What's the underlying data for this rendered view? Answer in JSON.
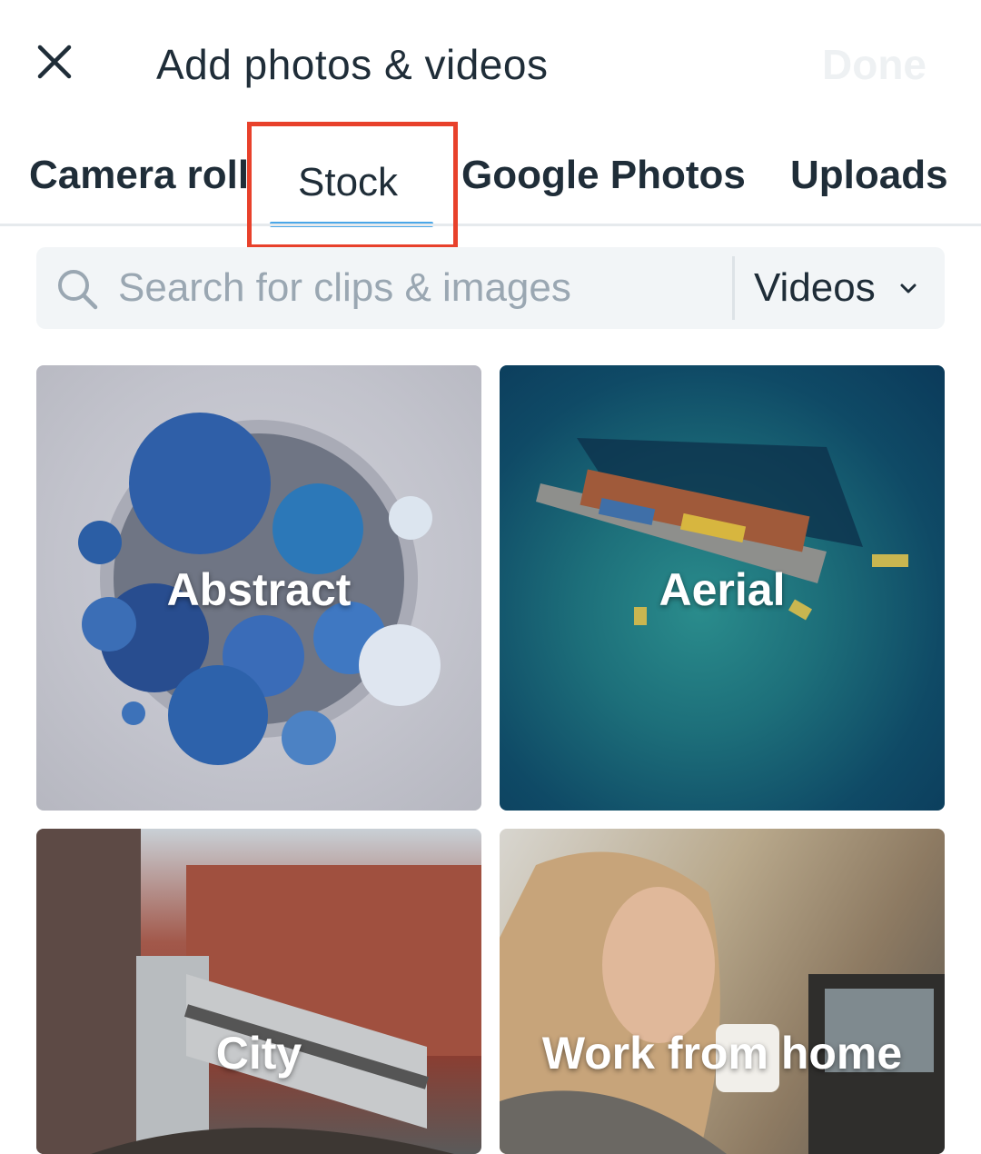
{
  "header": {
    "title": "Add photos & videos",
    "done_label": "Done"
  },
  "tabs": [
    {
      "label": "Camera roll"
    },
    {
      "label": "Stock"
    },
    {
      "label": "Google Photos"
    },
    {
      "label": "Uploads"
    }
  ],
  "active_tab": "Stock",
  "search": {
    "placeholder": "Search for clips & images",
    "value": "",
    "filter_label": "Videos"
  },
  "categories": [
    {
      "label": "Abstract"
    },
    {
      "label": "Aerial"
    },
    {
      "label": "City"
    },
    {
      "label": "Work from home"
    }
  ],
  "colors": {
    "text": "#1f2d38",
    "accent": "#4aa7e8",
    "highlight": "#e8412b",
    "search_bg": "#f2f5f7",
    "placeholder": "#9aa7b2"
  }
}
